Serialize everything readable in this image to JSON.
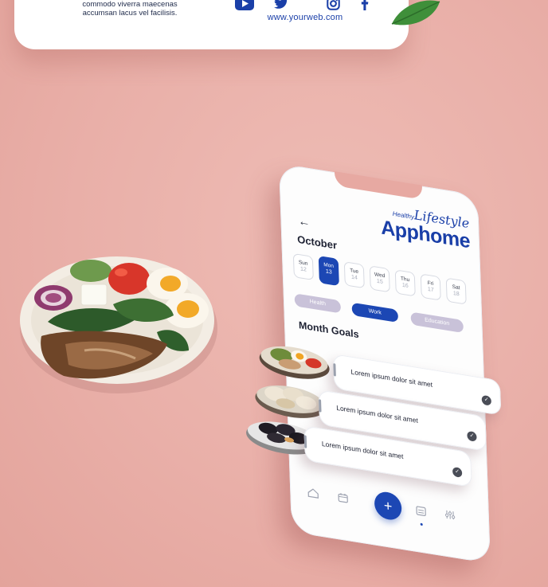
{
  "top_card": {
    "description_lines": [
      "commodo viverra maecenas",
      "accumsan lacus vel facilisis."
    ],
    "social_icons": [
      "youtube-icon",
      "twitter-icon",
      "instagram-icon",
      "facebook-icon"
    ],
    "website": "www.yourweb.com"
  },
  "app": {
    "brand_small": "Healthy",
    "brand_script": "Lifestyle",
    "brand_main": "Apphome",
    "back_icon": "←",
    "month": "October",
    "days": [
      {
        "name": "Sun",
        "date": "12"
      },
      {
        "name": "Mon",
        "date": "13"
      },
      {
        "name": "Tue",
        "date": "14"
      },
      {
        "name": "Wed",
        "date": "15"
      },
      {
        "name": "Thu",
        "date": "16"
      },
      {
        "name": "Fri",
        "date": "17"
      },
      {
        "name": "Sat",
        "date": "18"
      }
    ],
    "selected_day": "Mon",
    "tags": [
      {
        "label": "Health",
        "active": false
      },
      {
        "label": "Work",
        "active": true
      },
      {
        "label": "Education",
        "active": false
      }
    ],
    "goals_title": "Month Goals",
    "goals": [
      {
        "text": "Lorem ipsum dolor sit amet",
        "done": true
      },
      {
        "text": "Lorem ipsum dolor sit amet",
        "done": true
      },
      {
        "text": "Lorem ipsum dolor sit amet",
        "done": true
      }
    ],
    "nav": {
      "items": [
        "home-icon",
        "calendar-icon",
        "add-icon",
        "planner-icon",
        "settings-sliders-icon"
      ],
      "add_symbol": "+",
      "active": "planner-icon"
    }
  },
  "colors": {
    "accent": "#1c47b4",
    "background": "#eab1aa",
    "tag_inactive": "#c9c2d9"
  }
}
